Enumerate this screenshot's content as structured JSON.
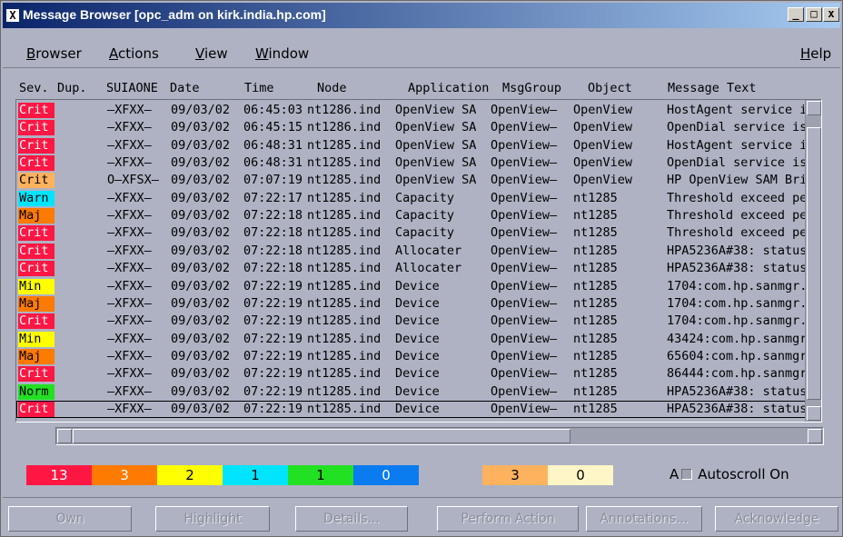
{
  "window": {
    "title": "Message Browser  [opc_adm on kirk.india.hp.com]",
    "icon_glyph": "X",
    "minimize": "_",
    "maximize": "□",
    "close": "x"
  },
  "menu": {
    "browser": "Browser",
    "actions": "Actions",
    "view": "View",
    "window": "Window",
    "help": "Help"
  },
  "columns": {
    "sev": "Sev.",
    "dup": "Dup.",
    "suiaone": "SUIAONE",
    "date": "Date",
    "time": "Time",
    "node": "Node",
    "application": "Application",
    "msggroup": "MsgGroup",
    "object": "Object",
    "message": "Message Text"
  },
  "rows": [
    {
      "sev": "Crit",
      "cls": "crit",
      "flags": "—XFXX—",
      "date": "09/03/02",
      "time": "06:45:03",
      "node": "nt1286.ind",
      "app": "OpenView SA",
      "group": "OpenView—",
      "object": "OpenView",
      "text": "HostAgent service i"
    },
    {
      "sev": "Crit",
      "cls": "crit",
      "flags": "—XFXX—",
      "date": "09/03/02",
      "time": "06:45:15",
      "node": "nt1286.ind",
      "app": "OpenView SA",
      "group": "OpenView—",
      "object": "OpenView",
      "text": "OpenDial service is"
    },
    {
      "sev": "Crit",
      "cls": "crit",
      "flags": "—XFXX—",
      "date": "09/03/02",
      "time": "06:48:31",
      "node": "nt1285.ind",
      "app": "OpenView SA",
      "group": "OpenView—",
      "object": "OpenView",
      "text": "HostAgent service i"
    },
    {
      "sev": "Crit",
      "cls": "crit",
      "flags": "—XFXX—",
      "date": "09/03/02",
      "time": "06:48:31",
      "node": "nt1285.ind",
      "app": "OpenView SA",
      "group": "OpenView—",
      "object": "OpenView",
      "text": "OpenDial service is"
    },
    {
      "sev": "Crit",
      "cls": "critw",
      "flags": "O—XFSX—",
      "date": "09/03/02",
      "time": "07:07:19",
      "node": "nt1285.ind",
      "app": "OpenView SA",
      "group": "OpenView—",
      "object": "OpenView",
      "text": "HP OpenView SAM Bri"
    },
    {
      "sev": "Warn",
      "cls": "warn",
      "flags": "—XFXX—",
      "date": "09/03/02",
      "time": "07:22:17",
      "node": "nt1285.ind",
      "app": "Capacity",
      "group": "OpenView—",
      "object": "nt1285",
      "text": "Threshold exceed pe"
    },
    {
      "sev": "Maj",
      "cls": "maj",
      "flags": "—XFXX—",
      "date": "09/03/02",
      "time": "07:22:18",
      "node": "nt1285.ind",
      "app": "Capacity",
      "group": "OpenView—",
      "object": "nt1285",
      "text": "Threshold exceed pe"
    },
    {
      "sev": "Crit",
      "cls": "crit",
      "flags": "—XFXX—",
      "date": "09/03/02",
      "time": "07:22:18",
      "node": "nt1285.ind",
      "app": "Capacity",
      "group": "OpenView—",
      "object": "nt1285",
      "text": "Threshold exceed pe"
    },
    {
      "sev": "Crit",
      "cls": "crit",
      "flags": "—XFXX—",
      "date": "09/03/02",
      "time": "07:22:18",
      "node": "nt1285.ind",
      "app": "Allocater",
      "group": "OpenView—",
      "object": "nt1285",
      "text": "HPA5236A#38: status"
    },
    {
      "sev": "Crit",
      "cls": "crit",
      "flags": "—XFXX—",
      "date": "09/03/02",
      "time": "07:22:18",
      "node": "nt1285.ind",
      "app": "Allocater",
      "group": "OpenView—",
      "object": "nt1285",
      "text": "HPA5236A#38: status"
    },
    {
      "sev": "Min",
      "cls": "min",
      "flags": "—XFXX—",
      "date": "09/03/02",
      "time": "07:22:19",
      "node": "nt1285.ind",
      "app": "Device",
      "group": "OpenView—",
      "object": "nt1285",
      "text": "1704:com.hp.sanmgr."
    },
    {
      "sev": "Maj",
      "cls": "maj",
      "flags": "—XFXX—",
      "date": "09/03/02",
      "time": "07:22:19",
      "node": "nt1285.ind",
      "app": "Device",
      "group": "OpenView—",
      "object": "nt1285",
      "text": "1704:com.hp.sanmgr."
    },
    {
      "sev": "Crit",
      "cls": "crit",
      "flags": "—XFXX—",
      "date": "09/03/02",
      "time": "07:22:19",
      "node": "nt1285.ind",
      "app": "Device",
      "group": "OpenView—",
      "object": "nt1285",
      "text": "1704:com.hp.sanmgr."
    },
    {
      "sev": "Min",
      "cls": "min",
      "flags": "—XFXX—",
      "date": "09/03/02",
      "time": "07:22:19",
      "node": "nt1285.ind",
      "app": "Device",
      "group": "OpenView—",
      "object": "nt1285",
      "text": "43424:com.hp.sanmgr"
    },
    {
      "sev": "Maj",
      "cls": "maj",
      "flags": "—XFXX—",
      "date": "09/03/02",
      "time": "07:22:19",
      "node": "nt1285.ind",
      "app": "Device",
      "group": "OpenView—",
      "object": "nt1285",
      "text": "65604:com.hp.sanmgr"
    },
    {
      "sev": "Crit",
      "cls": "crit",
      "flags": "—XFXX—",
      "date": "09/03/02",
      "time": "07:22:19",
      "node": "nt1285.ind",
      "app": "Device",
      "group": "OpenView—",
      "object": "nt1285",
      "text": "86444:com.hp.sanmgr"
    },
    {
      "sev": "Norm",
      "cls": "norm",
      "flags": "—XFXX—",
      "date": "09/03/02",
      "time": "07:22:19",
      "node": "nt1285.ind",
      "app": "Device",
      "group": "OpenView—",
      "object": "nt1285",
      "text": "HPA5236A#38: status"
    },
    {
      "sev": "Crit",
      "cls": "crit",
      "flags": "—XFXX—",
      "date": "09/03/02",
      "time": "07:22:19",
      "node": "nt1285.ind",
      "app": "Device",
      "group": "OpenView—",
      "object": "nt1285",
      "text": "HPA5236A#38: status",
      "selected": true
    }
  ],
  "counts": [
    {
      "value": "13",
      "color": "#ff1744",
      "text_color": "#ffffff"
    },
    {
      "value": "3",
      "color": "#ff7a00",
      "text_color": "#ffffff"
    },
    {
      "value": "2",
      "color": "#ffff00",
      "text_color": "#000000"
    },
    {
      "value": "1",
      "color": "#00e5ff",
      "text_color": "#000000"
    },
    {
      "value": "1",
      "color": "#22e022",
      "text_color": "#000000"
    },
    {
      "value": "0",
      "color": "#0a7cf0",
      "text_color": "#ffffff"
    },
    {
      "value": "3",
      "color": "#ffb25e",
      "text_color": "#000000"
    },
    {
      "value": "0",
      "color": "#fff6c8",
      "text_color": "#000000"
    }
  ],
  "autoscroll": {
    "prefix": "A",
    "label": "Autoscroll On"
  },
  "buttons": {
    "own": "Own",
    "highlight": "Highlight",
    "details": "Details...",
    "perform_action": "Perform Action",
    "annotations": "Annotations...",
    "acknowledge": "Acknowledge"
  }
}
